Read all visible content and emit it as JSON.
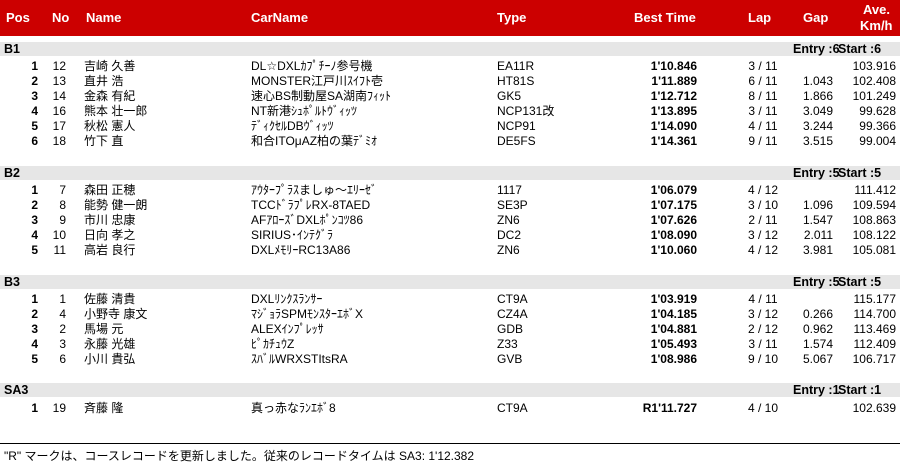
{
  "headers": {
    "pos": "Pos",
    "no": "No",
    "name": "Name",
    "car": "CarName",
    "type": "Type",
    "best": "Best Time",
    "lap": "Lap",
    "gap": "Gap",
    "ave1": "Ave.",
    "ave2": "Km/h"
  },
  "classes": [
    {
      "name": "B1",
      "entry": "Entry :6",
      "start": "Start :6",
      "rows": [
        {
          "pos": "1",
          "no": "12",
          "name": "吉崎 久善",
          "car": "DL☆DXLｶﾌﾟﾁｰﾉ参号機",
          "type": "EA11R",
          "best": "1'10.846",
          "lap": "3 / 11",
          "gap": "",
          "ave": "103.916"
        },
        {
          "pos": "2",
          "no": "13",
          "name": "直井 浩",
          "car": "MONSTER江戸川ｽｲﾌﾄ壱",
          "type": "HT81S",
          "best": "1'11.889",
          "lap": "6 / 11",
          "gap": "1.043",
          "ave": "102.408"
        },
        {
          "pos": "3",
          "no": "14",
          "name": "金森 有紀",
          "car": "速心BS制動屋SA湖南ﾌｨｯﾄ",
          "type": "GK5",
          "best": "1'12.712",
          "lap": "8 / 11",
          "gap": "1.866",
          "ave": "101.249"
        },
        {
          "pos": "4",
          "no": "16",
          "name": "熊本 壮一郎",
          "car": "NT新港ｼｭﾎﾟﾙﾄｳﾞｨｯﾂ",
          "type": "NCP131改",
          "best": "1'13.895",
          "lap": "3 / 11",
          "gap": "3.049",
          "ave": "99.628"
        },
        {
          "pos": "5",
          "no": "17",
          "name": "秋松 憲人",
          "car": "ﾃﾞｨｸｾﾙDBｳﾞｨｯﾂ",
          "type": "NCP91",
          "best": "1'14.090",
          "lap": "4 / 11",
          "gap": "3.244",
          "ave": "99.366"
        },
        {
          "pos": "6",
          "no": "18",
          "name": "竹下 直",
          "car": "和合ITOμAZ柏の葉ﾃﾞﾐｵ",
          "type": "DE5FS",
          "best": "1'14.361",
          "lap": "9 / 11",
          "gap": "3.515",
          "ave": "99.004"
        }
      ]
    },
    {
      "name": "B2",
      "entry": "Entry :5",
      "start": "Start :5",
      "rows": [
        {
          "pos": "1",
          "no": "7",
          "name": "森田 正穂",
          "car": "ｱｳﾀｰﾌﾟﾗｽましゅ～ｴﾘｰｾﾞ",
          "type": "1117",
          "best": "1'06.079",
          "lap": "4 / 12",
          "gap": "",
          "ave": "111.412"
        },
        {
          "pos": "2",
          "no": "8",
          "name": "能勢 健一朗",
          "car": "TCCﾄﾞﾗﾌﾟﾚRX-8TAED",
          "type": "SE3P",
          "best": "1'07.175",
          "lap": "3 / 10",
          "gap": "1.096",
          "ave": "109.594"
        },
        {
          "pos": "3",
          "no": "9",
          "name": "市川 忠康",
          "car": "AFｱﾛｰｽﾞDXLﾎﾟﾝｺﾂ86",
          "type": "ZN6",
          "best": "1'07.626",
          "lap": "2 / 11",
          "gap": "1.547",
          "ave": "108.863"
        },
        {
          "pos": "4",
          "no": "10",
          "name": "日向 孝之",
          "car": "SIRIUS･ｲﾝﾃｸﾞﾗ",
          "type": "DC2",
          "best": "1'08.090",
          "lap": "3 / 12",
          "gap": "2.011",
          "ave": "108.122"
        },
        {
          "pos": "5",
          "no": "11",
          "name": "高岩 良行",
          "car": "DXLﾒﾓﾘｰRC13A86",
          "type": "ZN6",
          "best": "1'10.060",
          "lap": "4 / 12",
          "gap": "3.981",
          "ave": "105.081"
        }
      ]
    },
    {
      "name": "B3",
      "entry": "Entry :5",
      "start": "Start :5",
      "rows": [
        {
          "pos": "1",
          "no": "1",
          "name": "佐藤 清貴",
          "car": "DXLﾘﾝｸｽﾗﾝｻｰ",
          "type": "CT9A",
          "best": "1'03.919",
          "lap": "4 / 11",
          "gap": "",
          "ave": "115.177"
        },
        {
          "pos": "2",
          "no": "4",
          "name": "小野寺 康文",
          "car": "ﾏｼﾞｮﾗSPMﾓﾝｽﾀｰｴﾎﾞX",
          "type": "CZ4A",
          "best": "1'04.185",
          "lap": "3 / 12",
          "gap": "0.266",
          "ave": "114.700"
        },
        {
          "pos": "3",
          "no": "2",
          "name": "馬場 元",
          "car": "ALEXｲﾝﾌﾟﾚｯｻ",
          "type": "GDB",
          "best": "1'04.881",
          "lap": "2 / 12",
          "gap": "0.962",
          "ave": "113.469"
        },
        {
          "pos": "4",
          "no": "3",
          "name": "永藤 光雄",
          "car": "ﾋﾟｶﾁｭｳZ",
          "type": "Z33",
          "best": "1'05.493",
          "lap": "3 / 11",
          "gap": "1.574",
          "ave": "112.409"
        },
        {
          "pos": "5",
          "no": "6",
          "name": "小川 貴弘",
          "car": "ｽﾊﾞﾙWRXSTItsRA",
          "type": "GVB",
          "best": "1'08.986",
          "lap": "9 / 10",
          "gap": "5.067",
          "ave": "106.717"
        }
      ]
    },
    {
      "name": "SA3",
      "entry": "Entry :1",
      "start": "Start :1",
      "rows": [
        {
          "pos": "1",
          "no": "19",
          "name": "斉藤 隆",
          "car": "真っ赤なﾗﾝｴﾎﾞ8",
          "type": "CT9A",
          "best": "R1'11.727",
          "lap": "4 / 10",
          "gap": "",
          "ave": "102.639"
        }
      ]
    }
  ],
  "footer": "\"R\" マークは、コースレコードを更新しました。従来のレコードタイムは SA3: 1'12.382"
}
